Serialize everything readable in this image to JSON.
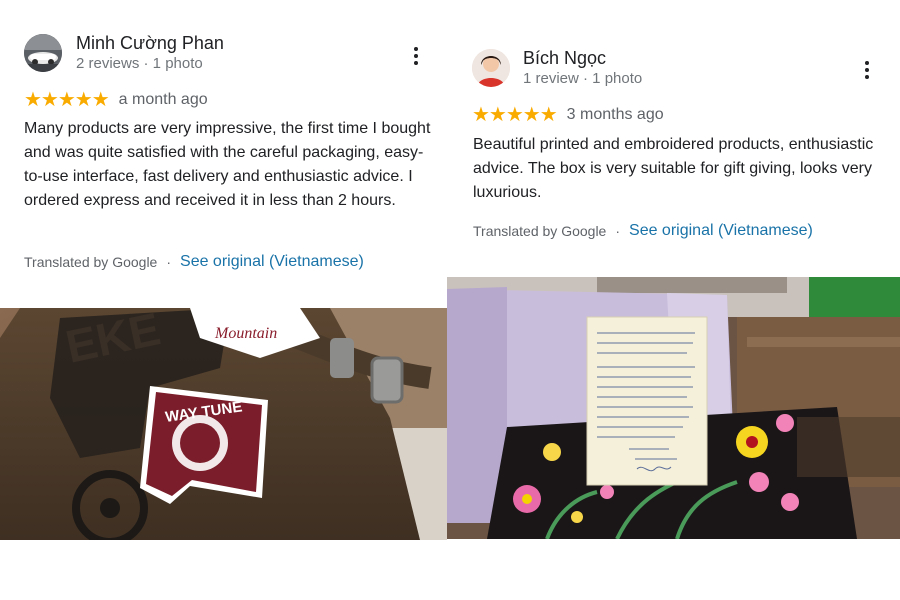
{
  "reviews": [
    {
      "author": "Minh Cường Phan",
      "meta": "2 reviews · 1 photo",
      "stars": "★★★★★",
      "rating": 5,
      "time": "a month ago",
      "text": "Many products are very impressive, the first time I bought and was quite satisfied with the careful packaging, easy-to-use interface, fast delivery and enthusiastic advice. I ordered express and received it in less than 2 hours.",
      "translated_by": "Translated by Google",
      "separator": "·",
      "see_original": "See original (Vietnamese)",
      "photo_sticker_text": "HIGHWAY TUNE"
    },
    {
      "author": "Bích Ngọc",
      "meta": "1 review · 1 photo",
      "stars": "★★★★★",
      "rating": 5,
      "time": "3 months ago",
      "text": "Beautiful printed and embroidered products, enthusiastic advice. The box is very suitable for gift giving, looks very luxurious.",
      "translated_by": "Translated by Google",
      "separator": "·",
      "see_original": "See original (Vietnamese)"
    }
  ],
  "colors": {
    "star": "#f9ab00",
    "link": "#1a73a8",
    "muted": "#70757a"
  },
  "icons": [
    "more-vert-icon",
    "star-icon"
  ]
}
